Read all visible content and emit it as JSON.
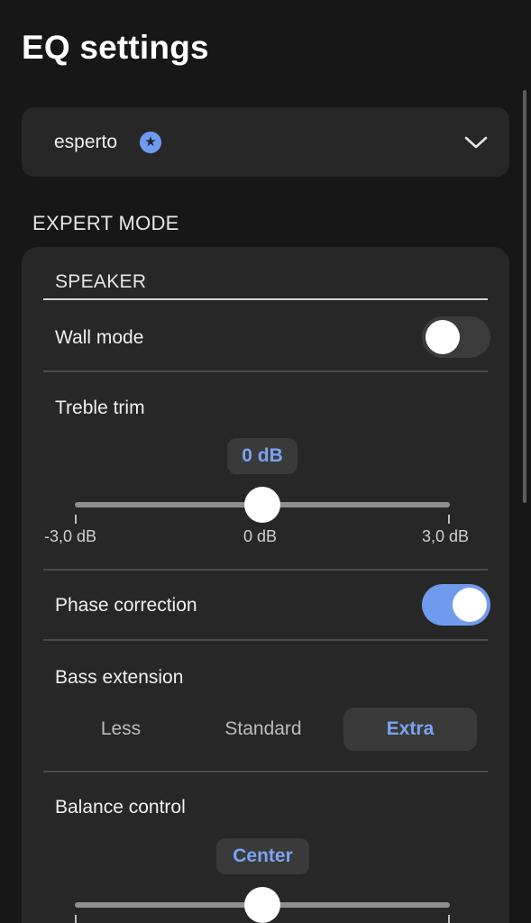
{
  "page": {
    "title": "EQ settings"
  },
  "preset": {
    "label": "esperto",
    "badge_icon": "star-icon"
  },
  "expert_mode": {
    "header": "EXPERT MODE",
    "speaker_header": "SPEAKER",
    "wall_mode": {
      "label": "Wall mode",
      "state": "off"
    },
    "treble_trim": {
      "label": "Treble trim",
      "value_label": "0 dB",
      "value": 0,
      "min": -3,
      "max": 3,
      "ticks": [
        "-3,0 dB",
        "0 dB",
        "3,0 dB"
      ]
    },
    "phase_correction": {
      "label": "Phase correction",
      "state": "on"
    },
    "bass_extension": {
      "label": "Bass extension",
      "options": [
        "Less",
        "Standard",
        "Extra"
      ],
      "selected": "Extra"
    },
    "balance_control": {
      "label": "Balance control",
      "value_label": "Center",
      "value": 0
    }
  },
  "colors": {
    "accent": "#6f9bef",
    "background": "#171717",
    "card": "#272727"
  }
}
